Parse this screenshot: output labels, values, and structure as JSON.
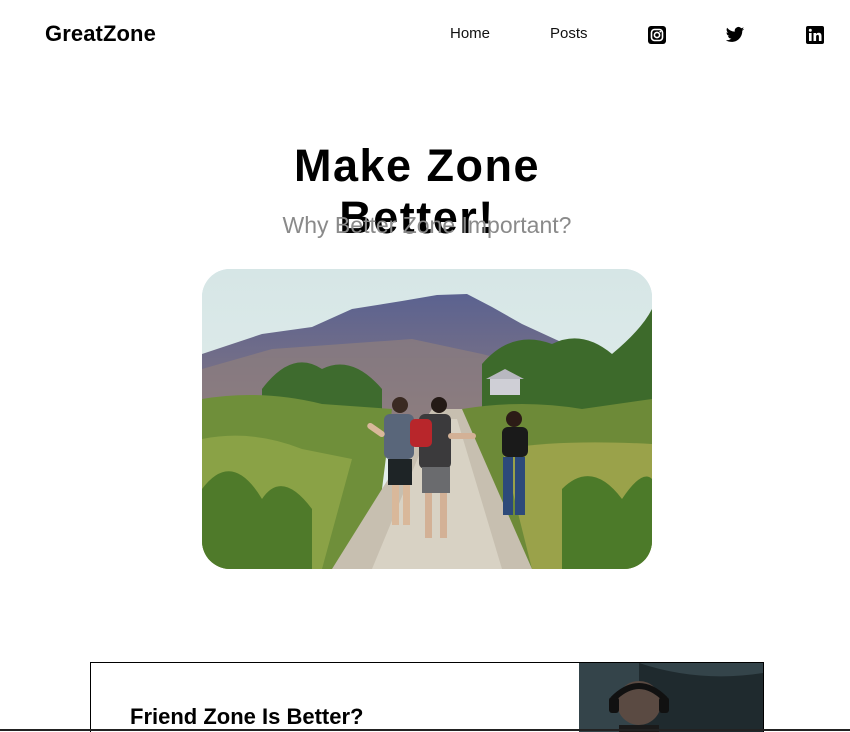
{
  "nav": {
    "brand": "GreatZone",
    "links": [
      {
        "label": "Home"
      },
      {
        "label": "Posts"
      }
    ],
    "social_icons": [
      "instagram-icon",
      "twitter-icon",
      "linkedin-icon"
    ]
  },
  "hero": {
    "title_line1": "Make Zone",
    "title_line2": "Better!",
    "subtitle": "Why Better Zone Important?"
  },
  "posts": [
    {
      "title": "Friend Zone Is Better?"
    }
  ],
  "colors": {
    "text": "#000000",
    "subtitle": "#8a8a8a",
    "background": "#ffffff"
  }
}
